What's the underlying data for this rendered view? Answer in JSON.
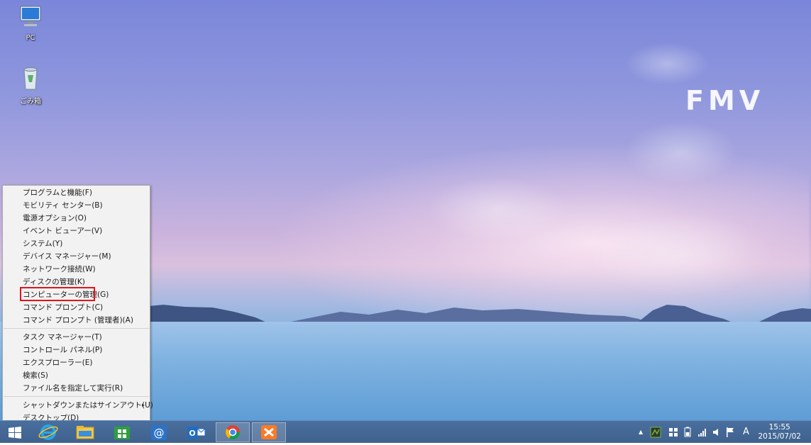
{
  "desktop": {
    "brand_logo": "FMV",
    "icons": [
      {
        "label": "PC",
        "icon": "computer-icon"
      },
      {
        "label": "ごみ箱",
        "icon": "recycle-bin-icon"
      }
    ]
  },
  "winx_menu": {
    "group1": [
      "プログラムと機能(F)",
      "モビリティ センター(B)",
      "電源オプション(O)",
      "イベント ビューアー(V)",
      "システム(Y)",
      "デバイス マネージャー(M)",
      "ネットワーク接続(W)",
      "ディスクの管理(K)",
      "コンピューターの管理(G)",
      "コマンド プロンプト(C)",
      "コマンド プロンプト (管理者)(A)"
    ],
    "group2": [
      "タスク マネージャー(T)",
      "コントロール パネル(P)",
      "エクスプローラー(E)",
      "検索(S)",
      "ファイル名を指定して実行(R)"
    ],
    "group3": [
      "シャットダウンまたはサインアウト(U)",
      "デスクトップ(D)"
    ],
    "submenu_arrow": "▸",
    "highlighted_item": "コンピューターの管理(G)"
  },
  "taskbar": {
    "pinned": [
      "start-button",
      "internet-explorer-icon",
      "file-explorer-icon",
      "windows-store-icon",
      "mail-at-icon",
      "outlook-icon",
      "chrome-icon",
      "xampp-icon"
    ],
    "tray": {
      "show_hidden": "▲",
      "ime": "A"
    },
    "clock": {
      "time": "15:55",
      "date": "2015/07/02"
    }
  },
  "colors": {
    "taskbar": "#3f618d",
    "menu_bg": "#f2f2f2",
    "highlight_border": "#e0141e"
  }
}
